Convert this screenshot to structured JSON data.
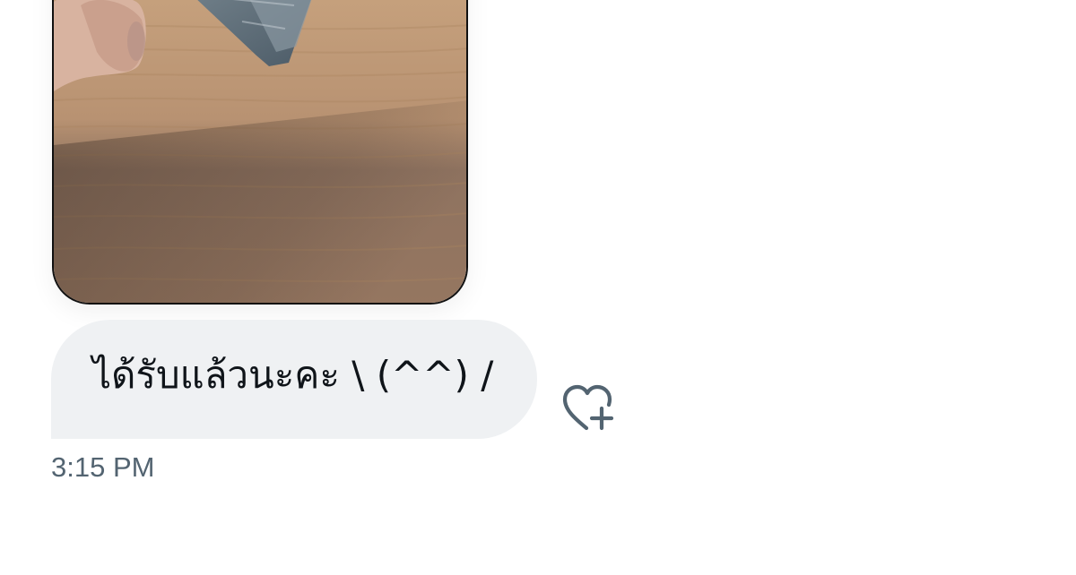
{
  "message": {
    "text": "ได้รับแล้วนะคะ \\ (^^) /",
    "timestamp": "3:15 PM"
  },
  "attachment": {
    "kind": "photo"
  },
  "icons": {
    "react": "heart-plus-icon"
  },
  "colors": {
    "bubble_bg": "#eff1f3",
    "text": "#0f1419",
    "muted": "#536471"
  }
}
